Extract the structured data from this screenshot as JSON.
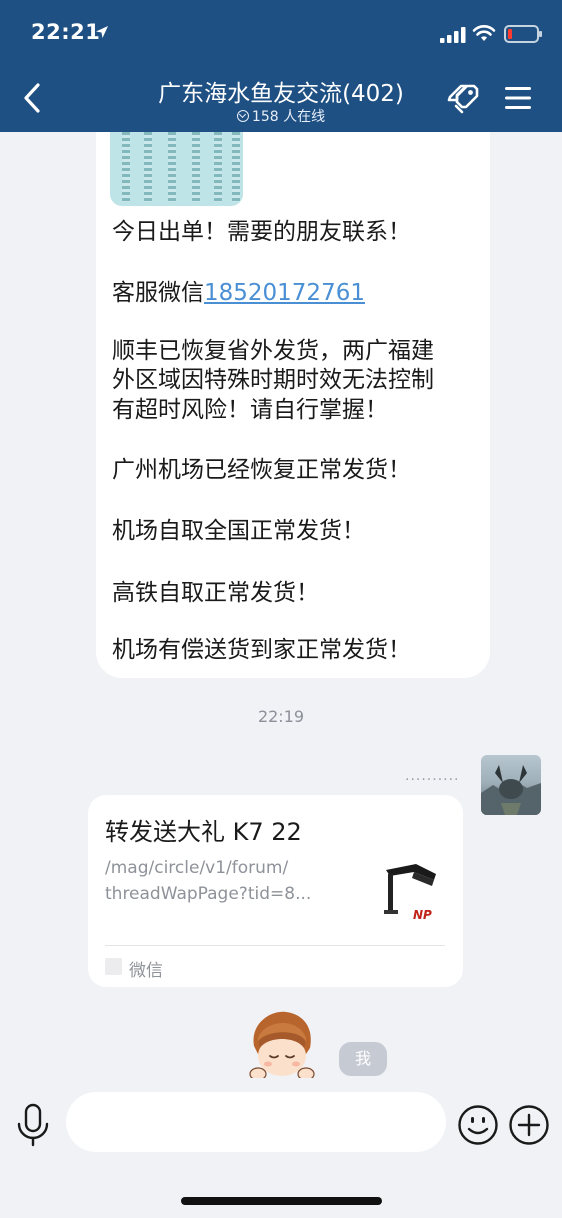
{
  "status_bar": {
    "time": "22:21",
    "battery_color": "#ff3b30"
  },
  "header": {
    "title": "广东海水鱼友交流(402)",
    "online_count": "158 人在线",
    "background": "#1f5083",
    "icons": [
      "back-arrow-icon",
      "topic-tag-icon",
      "menu-icon"
    ]
  },
  "messages": [
    {
      "type": "text",
      "image_thumbnail": true,
      "lines": [
        {
          "text": "今日出单！需要的朋友联系！"
        },
        {
          "text": "客服微信",
          "link": "18520172761"
        },
        {
          "text": "顺丰已恢复省外发货，两广福建"
        },
        {
          "text": "外区域因特殊时期时效无法控制"
        },
        {
          "text": "有超时风险！请自行掌握！"
        },
        {
          "text": "广州机场已经恢复正常发货！"
        },
        {
          "text": "机场自取全国正常发货！"
        },
        {
          "text": "高铁自取正常发货！"
        },
        {
          "text": "机场有偿送货到家正常发货！"
        }
      ]
    }
  ],
  "time_divider": "22:19",
  "share_card": {
    "sender_name": "..........",
    "title": "转发送大礼 K7 22",
    "url_line1": "/mag/circle/v1/forum/",
    "url_line2": "threadWapPage?tid=8...",
    "thumb_brand": "NP",
    "source": "微信"
  },
  "me_badge": "我",
  "input": {
    "placeholder": "",
    "value": ""
  }
}
